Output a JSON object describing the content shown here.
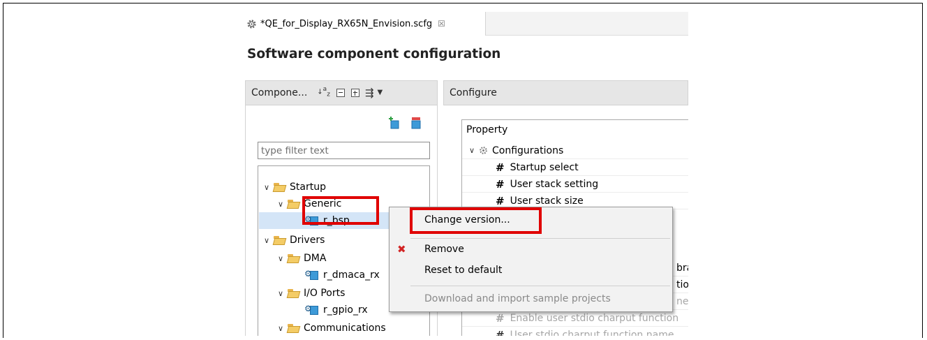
{
  "editor": {
    "tab_title": "*QE_for_Display_RX65N_Envision.scfg",
    "tab_close": "☒",
    "page_title": "Software component configuration"
  },
  "components_panel": {
    "title": "Compone...",
    "toolbar_icons": [
      "sort-alpha-icon",
      "collapse-all-icon",
      "expand-all-icon",
      "filter-menu-icon",
      "dropdown-arrow-icon"
    ],
    "filter_placeholder": "type filter text",
    "tree": [
      {
        "label": "Startup",
        "type": "folder",
        "level": 0,
        "expanded": true
      },
      {
        "label": "Generic",
        "type": "folder",
        "level": 1,
        "expanded": true
      },
      {
        "label": "r_bsp",
        "type": "component",
        "level": 2,
        "selected": true
      },
      {
        "label": "Drivers",
        "type": "folder",
        "level": 0,
        "expanded": true
      },
      {
        "label": "DMA",
        "type": "folder",
        "level": 1,
        "expanded": true
      },
      {
        "label": "r_dmaca_rx",
        "type": "component",
        "level": 2
      },
      {
        "label": "I/O Ports",
        "type": "folder",
        "level": 1,
        "expanded": true
      },
      {
        "label": "r_gpio_rx",
        "type": "component",
        "level": 2
      },
      {
        "label": "Communications",
        "type": "folder",
        "level": 1,
        "expanded": true
      }
    ]
  },
  "configure_panel": {
    "title": "Configure",
    "property_header": "Property",
    "group": "Configurations",
    "rows": [
      "Startup select",
      "User stack setting",
      "User stack size"
    ],
    "partial_rows": [
      "bra",
      "tio",
      "ne",
      "Enable user stdio charput function",
      "User stdio charput function name"
    ]
  },
  "context_menu": {
    "items": [
      {
        "label": "Change version...",
        "enabled": true,
        "highlighted": true
      },
      {
        "label": "Remove",
        "enabled": true,
        "icon": "red-x-icon"
      },
      {
        "label": "Reset to default",
        "enabled": true
      },
      {
        "label": "Download and import sample projects",
        "enabled": false
      }
    ]
  },
  "colors": {
    "highlight_box": "#e00000",
    "selection": "#d4e5f7",
    "folder": "#f4cc66",
    "component_cube": "#3d9ad8"
  }
}
